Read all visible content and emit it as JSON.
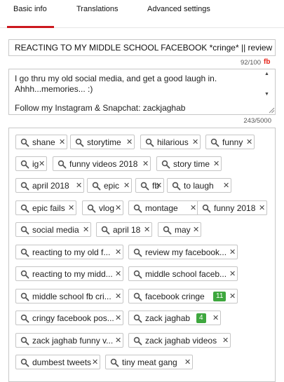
{
  "tabs": [
    {
      "label": "Basic info",
      "active": true
    },
    {
      "label": "Translations",
      "active": false
    },
    {
      "label": "Advanced settings",
      "active": false
    }
  ],
  "title": {
    "value": "REACTING TO MY MIDDLE SCHOOL FACEBOOK *cringe* || review my",
    "counter": "92/100",
    "badge": "fb"
  },
  "description": {
    "lines": [
      "I go thru my old social media, and get a good laugh in.",
      "Ahhh...memories... :)",
      "",
      "Follow my Instagram & Snapchat: zackjaghab"
    ],
    "counter": "243/5000"
  },
  "tags": [
    {
      "label": "shane",
      "count": ""
    },
    {
      "label": "storytime",
      "count": ""
    },
    {
      "label": "hilarious",
      "count": ""
    },
    {
      "label": "funny",
      "count": ""
    },
    {
      "label": "ig",
      "count": ""
    },
    {
      "label": "funny videos 2018",
      "count": ""
    },
    {
      "label": "story time",
      "count": ""
    },
    {
      "label": "april 2018",
      "count": ""
    },
    {
      "label": "epic",
      "count": ""
    },
    {
      "label": "fb",
      "count": ""
    },
    {
      "label": "to laugh",
      "count": ""
    },
    {
      "label": "epic fails",
      "count": ""
    },
    {
      "label": "vlog",
      "count": ""
    },
    {
      "label": "montage",
      "count": ""
    },
    {
      "label": "funny 2018",
      "count": ""
    },
    {
      "label": "social media",
      "count": ""
    },
    {
      "label": "april 18",
      "count": ""
    },
    {
      "label": "may",
      "count": ""
    },
    {
      "label": "reacting to my old f...",
      "count": ""
    },
    {
      "label": "review my facebook...",
      "count": ""
    },
    {
      "label": "reacting to my midd...",
      "count": ""
    },
    {
      "label": "middle school faceb...",
      "count": ""
    },
    {
      "label": "middle school fb cri...",
      "count": ""
    },
    {
      "label": "facebook cringe",
      "count": "11"
    },
    {
      "label": "cringy facebook pos...",
      "count": ""
    },
    {
      "label": "zack jaghab",
      "count": "4"
    },
    {
      "label": "zack jaghab funny v...",
      "count": ""
    },
    {
      "label": "zack jaghab videos",
      "count": ""
    },
    {
      "label": "dumbest tweets",
      "count": ""
    },
    {
      "label": "tiny meat gang",
      "count": ""
    }
  ],
  "icons": {
    "tag_search": "search-icon",
    "tag_remove": "close-icon",
    "scroll_up": "arrow-up-icon",
    "scroll_down": "arrow-down-icon",
    "resize": "resize-grip-icon"
  },
  "colors": {
    "accent": "#cc181e",
    "badge_red": "#e62117",
    "count_green": "#3ea73e",
    "border": "#c8c8c8"
  }
}
